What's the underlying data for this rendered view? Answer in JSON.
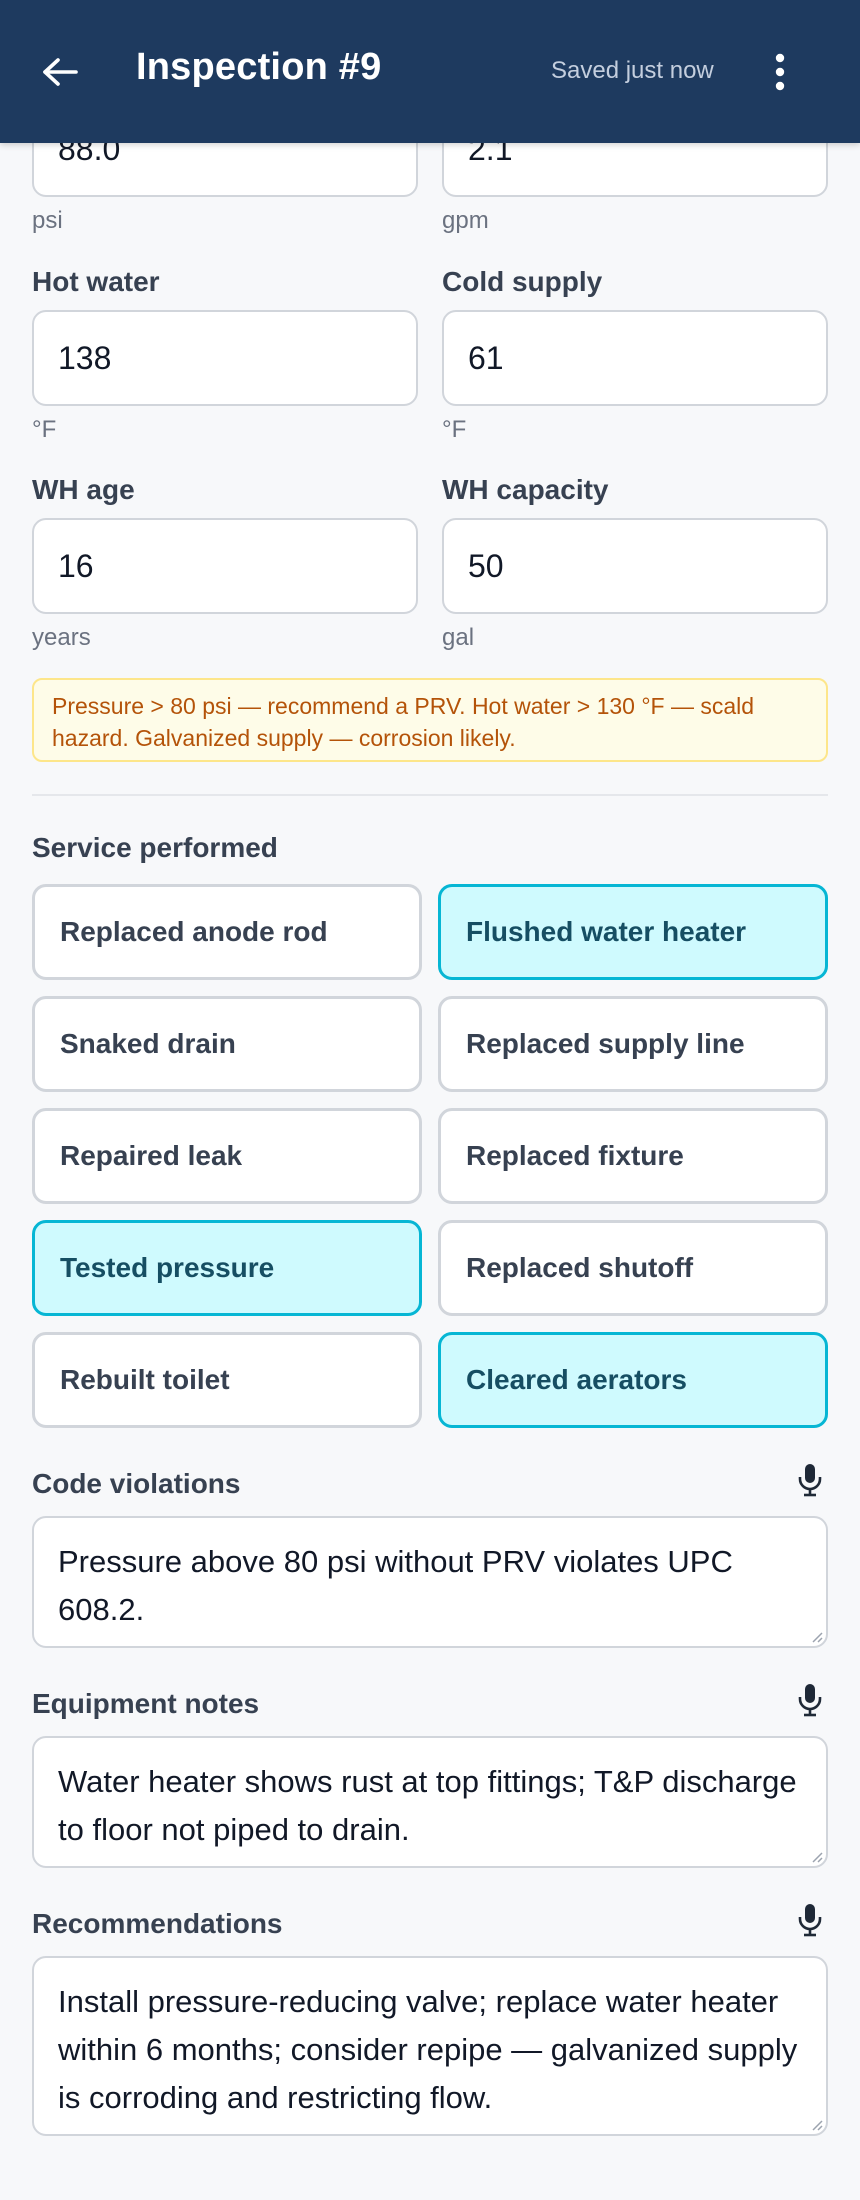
{
  "header": {
    "title": "Inspection #9",
    "status": "Saved just now"
  },
  "measurements": {
    "pressure": {
      "value": "88.0",
      "unit": "psi"
    },
    "flow": {
      "value": "2.1",
      "unit": "gpm"
    },
    "hot_water": {
      "label": "Hot water",
      "value": "138",
      "unit": "°F"
    },
    "cold_supply": {
      "label": "Cold supply",
      "value": "61",
      "unit": "°F"
    },
    "wh_age": {
      "label": "WH age",
      "value": "16",
      "unit": "years"
    },
    "wh_capacity": {
      "label": "WH capacity",
      "value": "50",
      "unit": "gal"
    }
  },
  "warning": "Pressure > 80 psi — recommend a PRV. Hot water > 130 °F — scald hazard. Galvanized supply — corrosion likely.",
  "services": {
    "label": "Service performed",
    "items": [
      {
        "label": "Replaced anode rod",
        "selected": false
      },
      {
        "label": "Flushed water heater",
        "selected": true
      },
      {
        "label": "Snaked drain",
        "selected": false
      },
      {
        "label": "Replaced supply line",
        "selected": false
      },
      {
        "label": "Repaired leak",
        "selected": false
      },
      {
        "label": "Replaced fixture",
        "selected": false
      },
      {
        "label": "Tested pressure",
        "selected": true
      },
      {
        "label": "Replaced shutoff",
        "selected": false
      },
      {
        "label": "Rebuilt toilet",
        "selected": false
      },
      {
        "label": "Cleared aerators",
        "selected": true
      }
    ]
  },
  "notes": {
    "code_violations": {
      "label": "Code violations",
      "value": "Pressure above 80 psi without PRV violates UPC 608.2."
    },
    "equipment_notes": {
      "label": "Equipment notes",
      "value": "Water heater shows rust at top fittings; T&P discharge to floor not piped to drain."
    },
    "recommendations": {
      "label": "Recommendations",
      "value": "Install pressure-reducing valve; replace water heater within 6 months; consider repipe — galvanized supply is corroding and restricting flow."
    }
  },
  "colors": {
    "header_bg": "#1e3a5f",
    "chip_selected_bg": "#cffafe",
    "chip_selected_border": "#06b6d4",
    "warning_bg": "#fefce8",
    "warning_text": "#b45309"
  }
}
